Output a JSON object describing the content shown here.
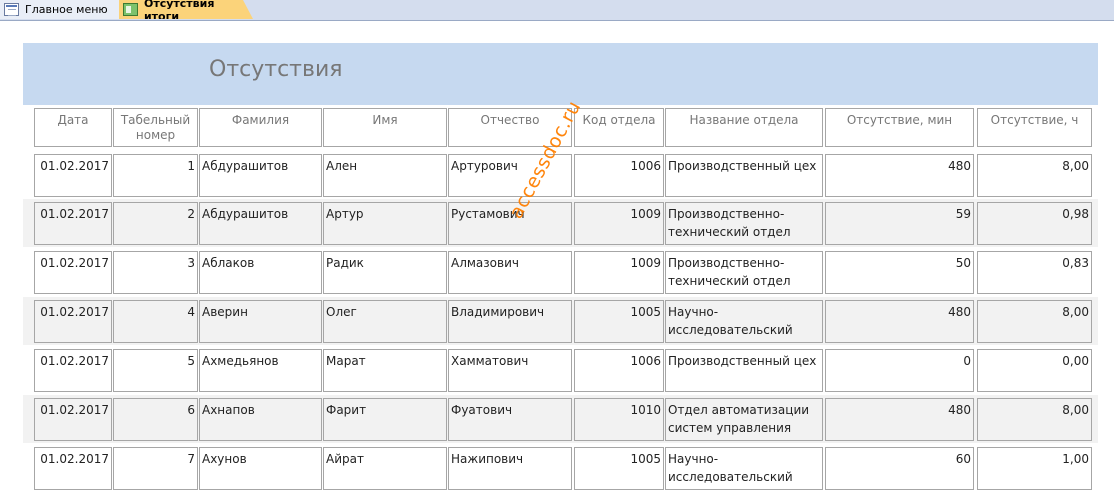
{
  "tabs": {
    "main": {
      "label": "Главное меню",
      "icon": "form-icon"
    },
    "active": {
      "label": "Отсутствия итоги",
      "icon": "report-icon"
    }
  },
  "report": {
    "title": "Отсутствия",
    "columns": [
      "Дата",
      "Табельный номер",
      "Фамилия",
      "Имя",
      "Отчество",
      "Код отдела",
      "Название отдела",
      "Отсутствие, мин",
      "Отсутствие, ч"
    ],
    "rows": [
      [
        "01.02.2017",
        "1",
        "Абдурашитов",
        "Ален",
        "Артурович",
        "1006",
        "Производственный цех",
        "480",
        "8,00"
      ],
      [
        "01.02.2017",
        "2",
        "Абдурашитов",
        "Артур",
        "Рустамович",
        "1009",
        "Производственно-технический отдел",
        "59",
        "0,98"
      ],
      [
        "01.02.2017",
        "3",
        "Аблаков",
        "Радик",
        "Алмазович",
        "1009",
        "Производственно-технический отдел",
        "50",
        "0,83"
      ],
      [
        "01.02.2017",
        "4",
        "Аверин",
        "Олег",
        "Владимирович",
        "1005",
        "Научно-исследовательский",
        "480",
        "8,00"
      ],
      [
        "01.02.2017",
        "5",
        "Ахмедьянов",
        "Марат",
        "Хамматович",
        "1006",
        "Производственный цех",
        "0",
        "0,00"
      ],
      [
        "01.02.2017",
        "6",
        "Ахнапов",
        "Фарит",
        "Фуатович",
        "1010",
        "Отдел автоматизации систем управления",
        "480",
        "8,00"
      ],
      [
        "01.02.2017",
        "7",
        "Ахунов",
        "Айрат",
        "Нажипович",
        "1005",
        "Научно-исследовательский",
        "60",
        "1,00"
      ]
    ]
  },
  "watermark": "accessdoc.ru"
}
